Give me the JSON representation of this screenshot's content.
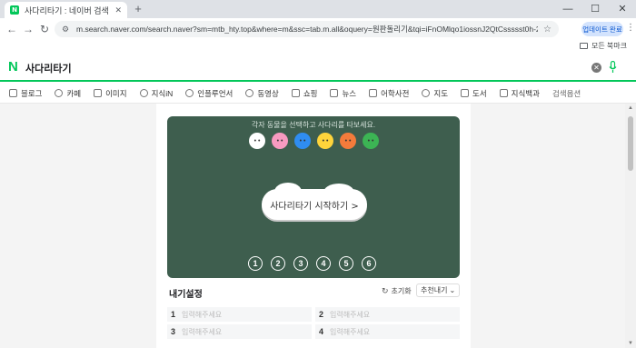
{
  "browser": {
    "tab_title": "사다리타기 : 네이버 검색",
    "favicon_letter": "N",
    "url": "m.search.naver.com/search.naver?sm=mtb_hty.top&where=m&ssc=tab.m.all&oquery=원판돌리기&tqi=iFnOMlqo1iossnJ2QtCssssst0h-270950&query=사다리...",
    "update_label": "업데이트 완료",
    "bookmarks_all": "모든 북마크"
  },
  "search": {
    "logo": "N",
    "query": "사다리타기"
  },
  "categories": [
    {
      "label": "블로그",
      "icon": "blog-icon"
    },
    {
      "label": "카페",
      "icon": "cafe-icon"
    },
    {
      "label": "이미지",
      "icon": "image-icon"
    },
    {
      "label": "지식iN",
      "icon": "search-icon"
    },
    {
      "label": "인플루언서",
      "icon": "person-icon"
    },
    {
      "label": "동영상",
      "icon": "play-icon"
    },
    {
      "label": "쇼핑",
      "icon": "bag-icon"
    },
    {
      "label": "뉴스",
      "icon": "news-icon"
    },
    {
      "label": "어학사전",
      "icon": "dictionary-icon"
    },
    {
      "label": "지도",
      "icon": "pin-icon"
    },
    {
      "label": "도서",
      "icon": "book-icon"
    },
    {
      "label": "지식백과",
      "icon": "cap-icon"
    },
    {
      "label": "검색옵션",
      "icon": ""
    }
  ],
  "ladder": {
    "hint": "각자 동물을 선택하고 사다리를 타보세요.",
    "start_label": "사다리타기 시작하기 >",
    "numbers": [
      "1",
      "2",
      "3",
      "4",
      "5",
      "6"
    ],
    "animals": [
      {
        "name": "bear",
        "color": "#ffffff"
      },
      {
        "name": "rabbit",
        "color": "#f79ac0"
      },
      {
        "name": "hedgehog",
        "color": "#2f8df0"
      },
      {
        "name": "chick",
        "color": "#ffd43b"
      },
      {
        "name": "fox",
        "color": "#f37b3b"
      },
      {
        "name": "frog",
        "color": "#3cb454"
      }
    ],
    "board_color": "#3e5e4e"
  },
  "settings": {
    "title": "내기설정",
    "reset_label": "초기화",
    "recommend_label": "추천내기",
    "placeholder": "입력해주세요",
    "rows": [
      [
        {
          "num": "1"
        },
        {
          "num": "2"
        }
      ],
      [
        {
          "num": "3"
        },
        {
          "num": "4"
        }
      ]
    ]
  }
}
